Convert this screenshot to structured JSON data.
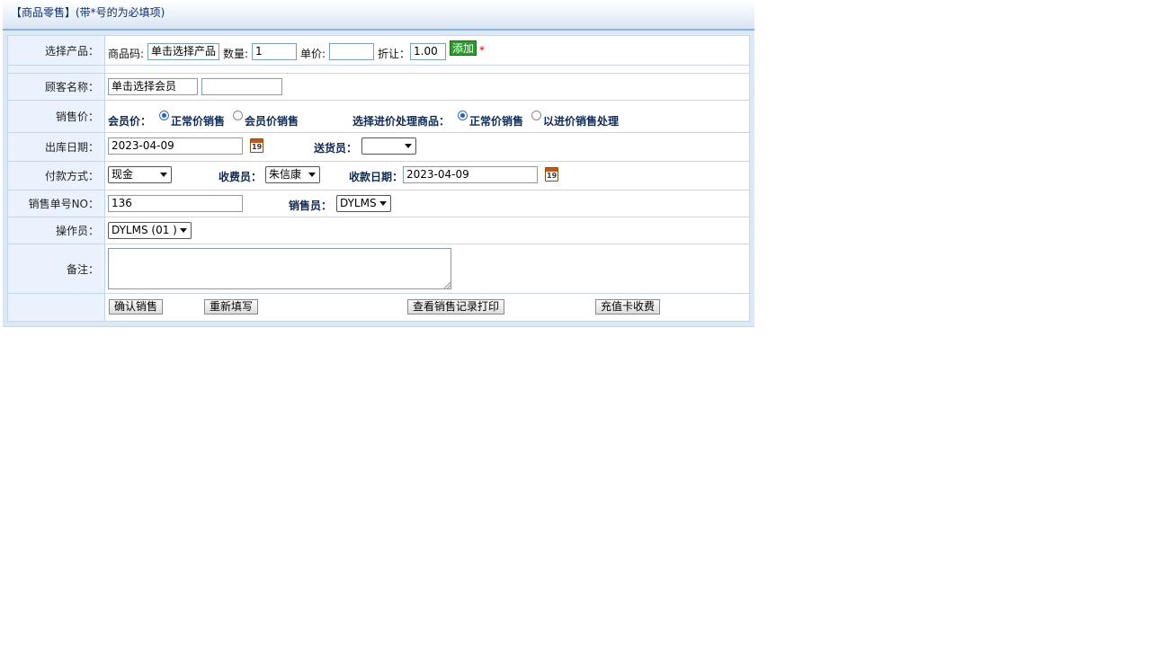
{
  "header": {
    "title": "【商品零售】(带*号的为必填项)"
  },
  "product_row": {
    "label": "选择产品：",
    "code_label": "商品码:",
    "code_value": "单击选择产品",
    "qty_label": "数量:",
    "qty_value": "1",
    "price_label": "单价:",
    "price_value": "",
    "discount_label": "折让：",
    "discount_value": "1.00",
    "add_label": "添加",
    "required_mark": "*"
  },
  "customer_row": {
    "label": "顾客名称：",
    "name_value": "单击选择会员",
    "extra_value": ""
  },
  "price_row": {
    "label": "销售价：",
    "member_price_label": "会员价：",
    "option_normal": "正常价销售",
    "option_member": "会员价销售",
    "cost_select_label": "选择进价处理商品：",
    "option_normal2": "正常价销售",
    "option_cost": "以进价销售处理"
  },
  "date_row": {
    "label": "出库日期：",
    "out_date": "2023-04-09",
    "calendar_text": "19",
    "delivery_label": "送货员：",
    "delivery_value": ""
  },
  "payment_row": {
    "label": "付款方式：",
    "payment_value": "现金",
    "cashier_label": "收费员：",
    "cashier_value": "朱信康",
    "pay_date_label": "收款日期：",
    "pay_date": "2023-04-09",
    "calendar_text": "19"
  },
  "order_row": {
    "label": "销售单号NO：",
    "order_no": "136",
    "seller_label": "销售员：",
    "seller_value": "DYLMS"
  },
  "operator_row": {
    "label": "操作员：",
    "operator_value": "DYLMS (01 )"
  },
  "remark_row": {
    "label": "备注：",
    "remark_value": ""
  },
  "actions": {
    "confirm": "确认销售",
    "reset": "重新填写",
    "print": "查看销售记录打印",
    "recharge": "充值卡收费"
  }
}
